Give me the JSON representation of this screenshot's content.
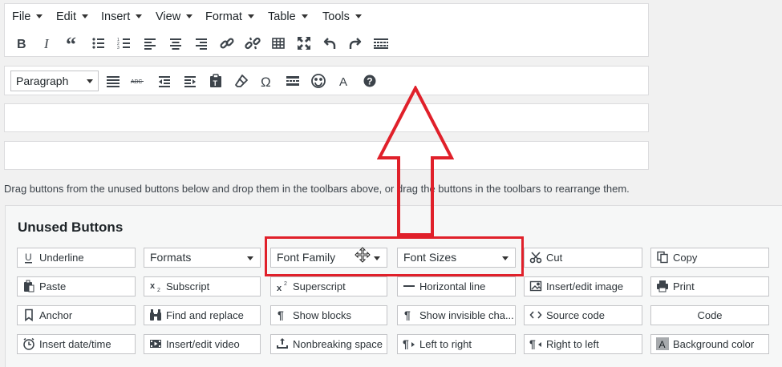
{
  "menubar": {
    "items": [
      {
        "label": "File"
      },
      {
        "label": "Edit"
      },
      {
        "label": "Insert"
      },
      {
        "label": "View"
      },
      {
        "label": "Format"
      },
      {
        "label": "Table"
      },
      {
        "label": "Tools"
      }
    ]
  },
  "toolbar1": {
    "icons": [
      "bold-icon",
      "italic-icon",
      "blockquote-icon",
      "bullet-list-icon",
      "numbered-list-icon",
      "align-left-icon",
      "align-center-icon",
      "align-right-icon",
      "link-icon",
      "unlink-icon",
      "table-icon",
      "fullscreen-icon",
      "undo-icon",
      "redo-icon",
      "toolbar-toggle-icon"
    ]
  },
  "toolbar2": {
    "paragraph_select": "Paragraph",
    "icons": [
      "justify-icon",
      "strikethrough-icon",
      "outdent-icon",
      "indent-icon",
      "paste-as-text-icon",
      "clear-formatting-icon",
      "special-character-icon",
      "read-more-icon",
      "emoticons-icon",
      "text-color-icon",
      "help-icon"
    ]
  },
  "help_text": "Drag buttons from the unused buttons below and drop them in the toolbars above, or drag the buttons in the toolbars to rearrange them.",
  "unused": {
    "title": "Unused Buttons",
    "rows": [
      [
        {
          "label": "Underline",
          "icon": "underline-icon"
        },
        {
          "label": "Formats",
          "type": "select"
        },
        {
          "label": "Font Family",
          "type": "select"
        },
        {
          "label": "Font Sizes",
          "type": "select"
        },
        {
          "label": "Cut",
          "icon": "scissors-icon"
        },
        {
          "label": "Copy",
          "icon": "copy-icon"
        }
      ],
      [
        {
          "label": "Paste",
          "icon": "paste-icon"
        },
        {
          "label": "Subscript",
          "icon": "subscript-icon"
        },
        {
          "label": "Superscript",
          "icon": "superscript-icon"
        },
        {
          "label": "Horizontal line",
          "icon": "horizontal-line-icon"
        },
        {
          "label": "Insert/edit image",
          "icon": "image-icon"
        },
        {
          "label": "Print",
          "icon": "print-icon"
        }
      ],
      [
        {
          "label": "Anchor",
          "icon": "anchor-icon"
        },
        {
          "label": "Find and replace",
          "icon": "binoculars-icon"
        },
        {
          "label": "Show blocks",
          "icon": "pilcrow-icon"
        },
        {
          "label": "Show invisible cha...",
          "icon": "pilcrow-icon"
        },
        {
          "label": "Source code",
          "icon": "code-icon"
        },
        {
          "label": "Code",
          "icon": ""
        }
      ],
      [
        {
          "label": "Insert date/time",
          "icon": "clock-icon"
        },
        {
          "label": "Insert/edit video",
          "icon": "video-icon"
        },
        {
          "label": "Nonbreaking space",
          "icon": "nbsp-icon"
        },
        {
          "label": "Left to right",
          "icon": "ltr-icon"
        },
        {
          "label": "Right to left",
          "icon": "rtl-icon"
        },
        {
          "label": "Background color",
          "icon": "background-color-icon"
        }
      ]
    ]
  },
  "colors": {
    "highlight": "#e0202a",
    "icon": "#3c434a"
  }
}
